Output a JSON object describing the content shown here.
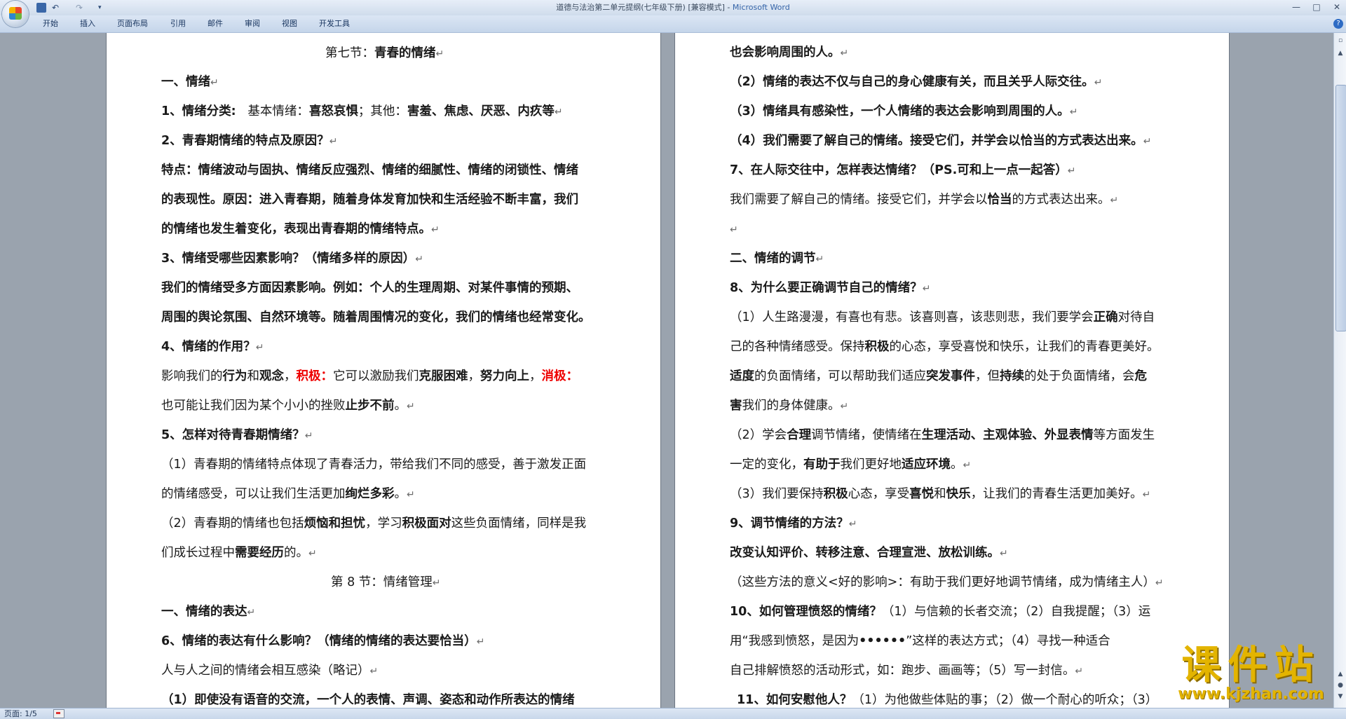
{
  "window": {
    "title": "道德与法治第二单元提纲(七年级下册) [兼容模式] - ",
    "app_name": "Microsoft Word"
  },
  "quick_access": {
    "undo": "↶",
    "redo": "↷",
    "more": "▾"
  },
  "ribbon_tabs": [
    "开始",
    "插入",
    "页面布局",
    "引用",
    "邮件",
    "审阅",
    "视图",
    "开发工具"
  ],
  "help": "?",
  "window_controls": {
    "min": "—",
    "max": "□",
    "close": "✕"
  },
  "paragraph_mark": "↵",
  "left_page": {
    "section_title_prefix": "第七节：",
    "section_title": "青春的情绪",
    "l01": "一、情绪",
    "l02_a": "1、情绪分类:",
    "l02_b": "基本情绪：",
    "l02_c": "喜怒哀惧",
    "l02_d": "；其他：",
    "l02_e": "害羞、焦虑、厌恶、内疚等",
    "l03": "2、青春期情绪的特点及原因？",
    "l04": "特点：情绪波动与固执、情绪反应强烈、情绪的细腻性、情绪的闭锁性、情绪",
    "l05": "的表现性。原因：进入青春期，随着身体发育加快和生活经验不断丰富，我们",
    "l06": "的情绪也发生着变化，表现出青春期的情绪特点。",
    "l07": "3、情绪受哪些因素影响？（情绪多样的原因）",
    "l08": "我们的情绪受多方面因素影响。例如：个人的生理周期、对某件事情的预期、",
    "l09": "周围的舆论氛围、自然环境等。随着周围情况的变化，我们的情绪也经常变化。",
    "l10": "4、情绪的作用？",
    "l11_a": "影响我们的",
    "l11_b": "行为",
    "l11_c": "和",
    "l11_d": "观念",
    "l11_e": "，",
    "l11_f": "积极：",
    "l11_g": "它可以激励我们",
    "l11_h": "克服困难",
    "l11_i": "，",
    "l11_j": "努力向上",
    "l11_k": "，",
    "l11_l": "消极：",
    "l12_a": "也可能让我们因为某个小小的挫败",
    "l12_b": "止步不前",
    "l12_c": "。",
    "l13": "5、怎样对待青春期情绪？",
    "l14": "（1）青春期的情绪特点体现了青春活力，带给我们不同的感受，善于激发正面",
    "l15_a": "的情绪感受，可以让我们生活更加",
    "l15_b": "绚烂多彩",
    "l15_c": "。",
    "l16_a": "（2）青春期的情绪也包括",
    "l16_b": "烦恼和担忧",
    "l16_c": "，学习",
    "l16_d": "积极面对",
    "l16_e": "这些负面情绪，同样是我",
    "l17_a": "们成长过程中",
    "l17_b": "需要经历",
    "l17_c": "的。",
    "l18": "第 8 节：情绪管理",
    "l19": "一、情绪的表达",
    "l20": "6、情绪的表达有什么影响？（情绪的情绪的表达要恰当）",
    "l21": "人与人之间的情绪会相互感染（略记）",
    "l22": "（1）即使没有语音的交流，一个人的表情、声调、姿态和动作所表达的情绪"
  },
  "right_page": {
    "r01": "也会影响周围的人。",
    "r02": "（2）情绪的表达不仅与自己的身心健康有关，而且关乎人际交往。",
    "r03": "（3）情绪具有感染性，一个人情绪的表达会影响到周围的人。",
    "r04": "（4）我们需要了解自己的情绪。接受它们，并学会以恰当的方式表达出来。",
    "r05": "7、在人际交往中，怎样表达情绪？（PS.可和上一点一起答）",
    "r06_a": "我们需要了解自己的情绪。接受它们，并学会以",
    "r06_b": "恰当",
    "r06_c": "的方式表达出来。",
    "r07": "",
    "r08": "二、情绪的调节",
    "r09": "8、为什么要正确调节自己的情绪？",
    "r10_a": "（1）人生路漫漫，有喜也有悲。该喜则喜，该悲则悲，我们要学会",
    "r10_b": "正确",
    "r10_c": "对待自",
    "r11_a": "己的各种情绪感受。保持",
    "r11_b": "积极",
    "r11_c": "的心态，享受喜悦和快乐，让我们的青春更美好。",
    "r12_a": "适度",
    "r12_b": "的负面情绪，可以帮助我们适应",
    "r12_c": "突发事件",
    "r12_d": "，但",
    "r12_e": "持续",
    "r12_f": "的处于负面情绪，会",
    "r12_g": "危",
    "r13_a": "害",
    "r13_b": "我们的身体健康。",
    "r14_a": "（2）学会",
    "r14_b": "合理",
    "r14_c": "调节情绪，使情绪在",
    "r14_d": "生理活动、主观体验、外显表情",
    "r14_e": "等方面发生",
    "r15_a": "一定的变化，",
    "r15_b": "有助于",
    "r15_c": "我们更好地",
    "r15_d": "适应环境",
    "r15_e": "。",
    "r16_a": "（3）我们要保持",
    "r16_b": "积极",
    "r16_c": "心态，享受",
    "r16_d": "喜悦",
    "r16_e": "和",
    "r16_f": "快乐",
    "r16_g": "，让我们的青春生活更加美好。",
    "r17": "9、调节情绪的方法？",
    "r18": "改变认知评价、转移注意、合理宣泄、放松训练。",
    "r19": "（这些方法的意义<好的影响>：有助于我们更好地调节情绪，成为情绪主人）",
    "r20_a": "10、如何管理愤怒的情绪？",
    "r20_b": "（1）与信赖的长者交流；（2）自我提醒；（3）运",
    "r21_a": "用“我感到愤怒，是因为",
    "r21_b": "••••••",
    "r21_c": "”这样的表达方式；（4）寻找一种适合",
    "r22": "自己排解愤怒的活动形式，如：跑步、画画等；（5）写一封信。",
    "r23_a": "11、如何安慰他人？",
    "r23_b": "（1）为他做些体贴的事；（2）做一个耐心的听众；（3）"
  },
  "status_bar": {
    "page_count": "页面: 1/5"
  },
  "watermark": {
    "text": "课件站",
    "url": "www.kjzhan.com"
  },
  "colors": {
    "accent_red": "#ee0000",
    "ribbon": "#c5d5ea",
    "background": "#9aa3ae",
    "watermark": "#e3b400"
  }
}
